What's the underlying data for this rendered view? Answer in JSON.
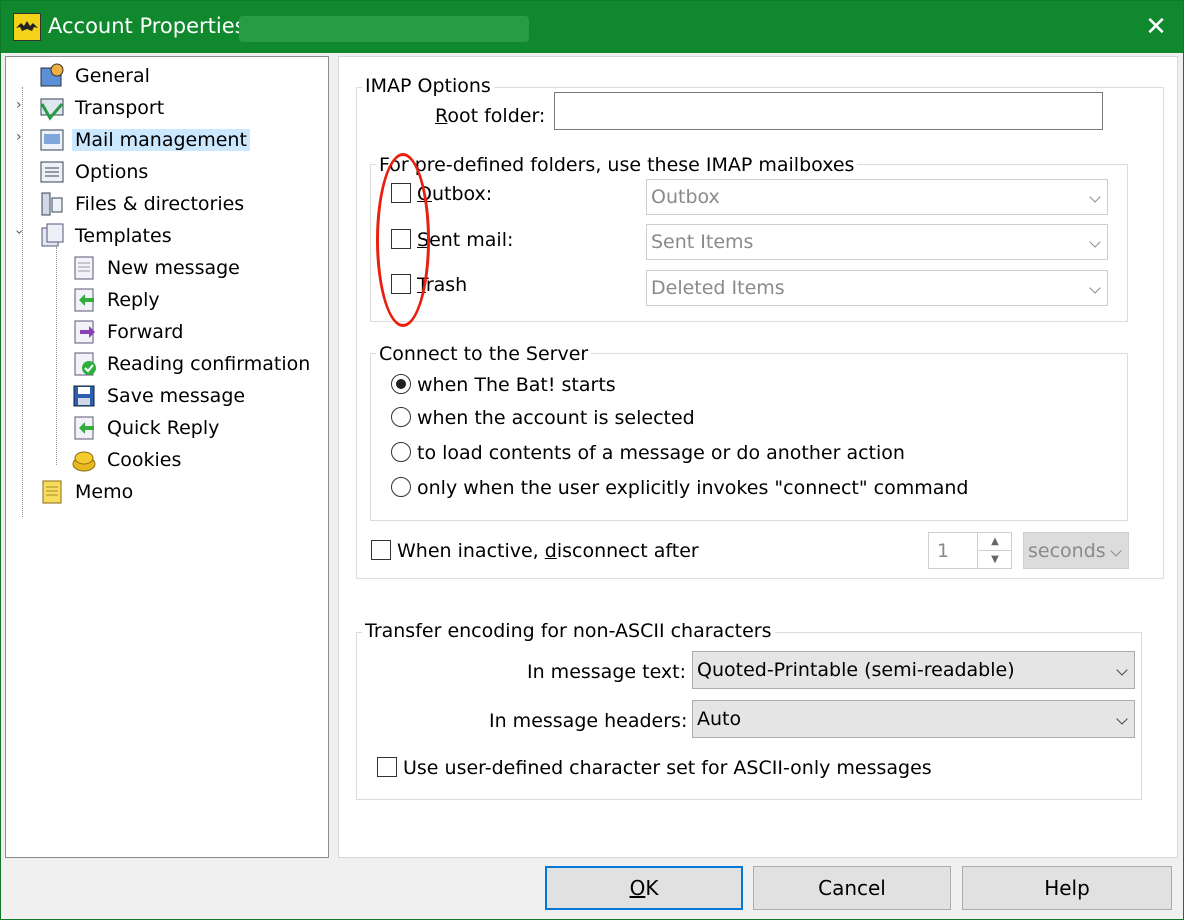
{
  "window": {
    "title": "Account Properties -",
    "close_glyph": "✕"
  },
  "tree": {
    "items": [
      {
        "label": "General",
        "icon": "general-icon"
      },
      {
        "label": "Transport",
        "icon": "transport-icon"
      },
      {
        "label": "Mail management",
        "icon": "mail-management-icon",
        "selected": true
      },
      {
        "label": "Options",
        "icon": "options-icon"
      },
      {
        "label": "Files & directories",
        "icon": "files-icon"
      },
      {
        "label": "Templates",
        "icon": "templates-icon"
      },
      {
        "label": "New message",
        "icon": "new-message-icon"
      },
      {
        "label": "Reply",
        "icon": "reply-icon"
      },
      {
        "label": "Forward",
        "icon": "forward-icon"
      },
      {
        "label": "Reading confirmation",
        "icon": "reading-confirmation-icon"
      },
      {
        "label": "Save message",
        "icon": "save-message-icon"
      },
      {
        "label": "Quick Reply",
        "icon": "quick-reply-icon"
      },
      {
        "label": "Cookies",
        "icon": "cookies-icon"
      },
      {
        "label": "Memo",
        "icon": "memo-icon"
      }
    ]
  },
  "imap": {
    "group_label": "IMAP Options",
    "root_folder_label_pre": "",
    "root_folder_label_u": "R",
    "root_folder_label_post": "oot folder:",
    "root_folder_value": "",
    "predefined_label": "For pre-defined folders, use these IMAP mailboxes",
    "outbox_u": "O",
    "outbox_post": "utbox:",
    "outbox_value": "Outbox",
    "sent_u": "S",
    "sent_post": "ent mail:",
    "sent_value": "Sent Items",
    "trash_u": "T",
    "trash_post": "rash",
    "trash_value": "Deleted Items"
  },
  "connect": {
    "group_label": "Connect to the Server",
    "options": [
      "when The Bat! starts",
      "when the account is selected",
      "to load contents of a message or do another action",
      "only when the user explicitly invokes \"connect\" command"
    ],
    "selected_index": 0,
    "inactive_pre": "When inactive, ",
    "inactive_u": "d",
    "inactive_post": "isconnect after",
    "inactive_value": "1",
    "inactive_unit": "seconds"
  },
  "encoding": {
    "group_label": "Transfer encoding for non-ASCII characters",
    "text_label": "In message text:",
    "text_value": "Quoted-Printable (semi-readable)",
    "headers_label": "In message headers:",
    "headers_value": "Auto",
    "ascii_label": "Use user-defined character set for ASCII-only messages"
  },
  "buttons": {
    "ok_u": "O",
    "ok_post": "K",
    "cancel": "Cancel",
    "help": "Help"
  },
  "colors": {
    "titlebar": "#10892e",
    "selection": "#cce8ff",
    "annotation": "#e82010",
    "default_button_border": "#0078d7"
  }
}
